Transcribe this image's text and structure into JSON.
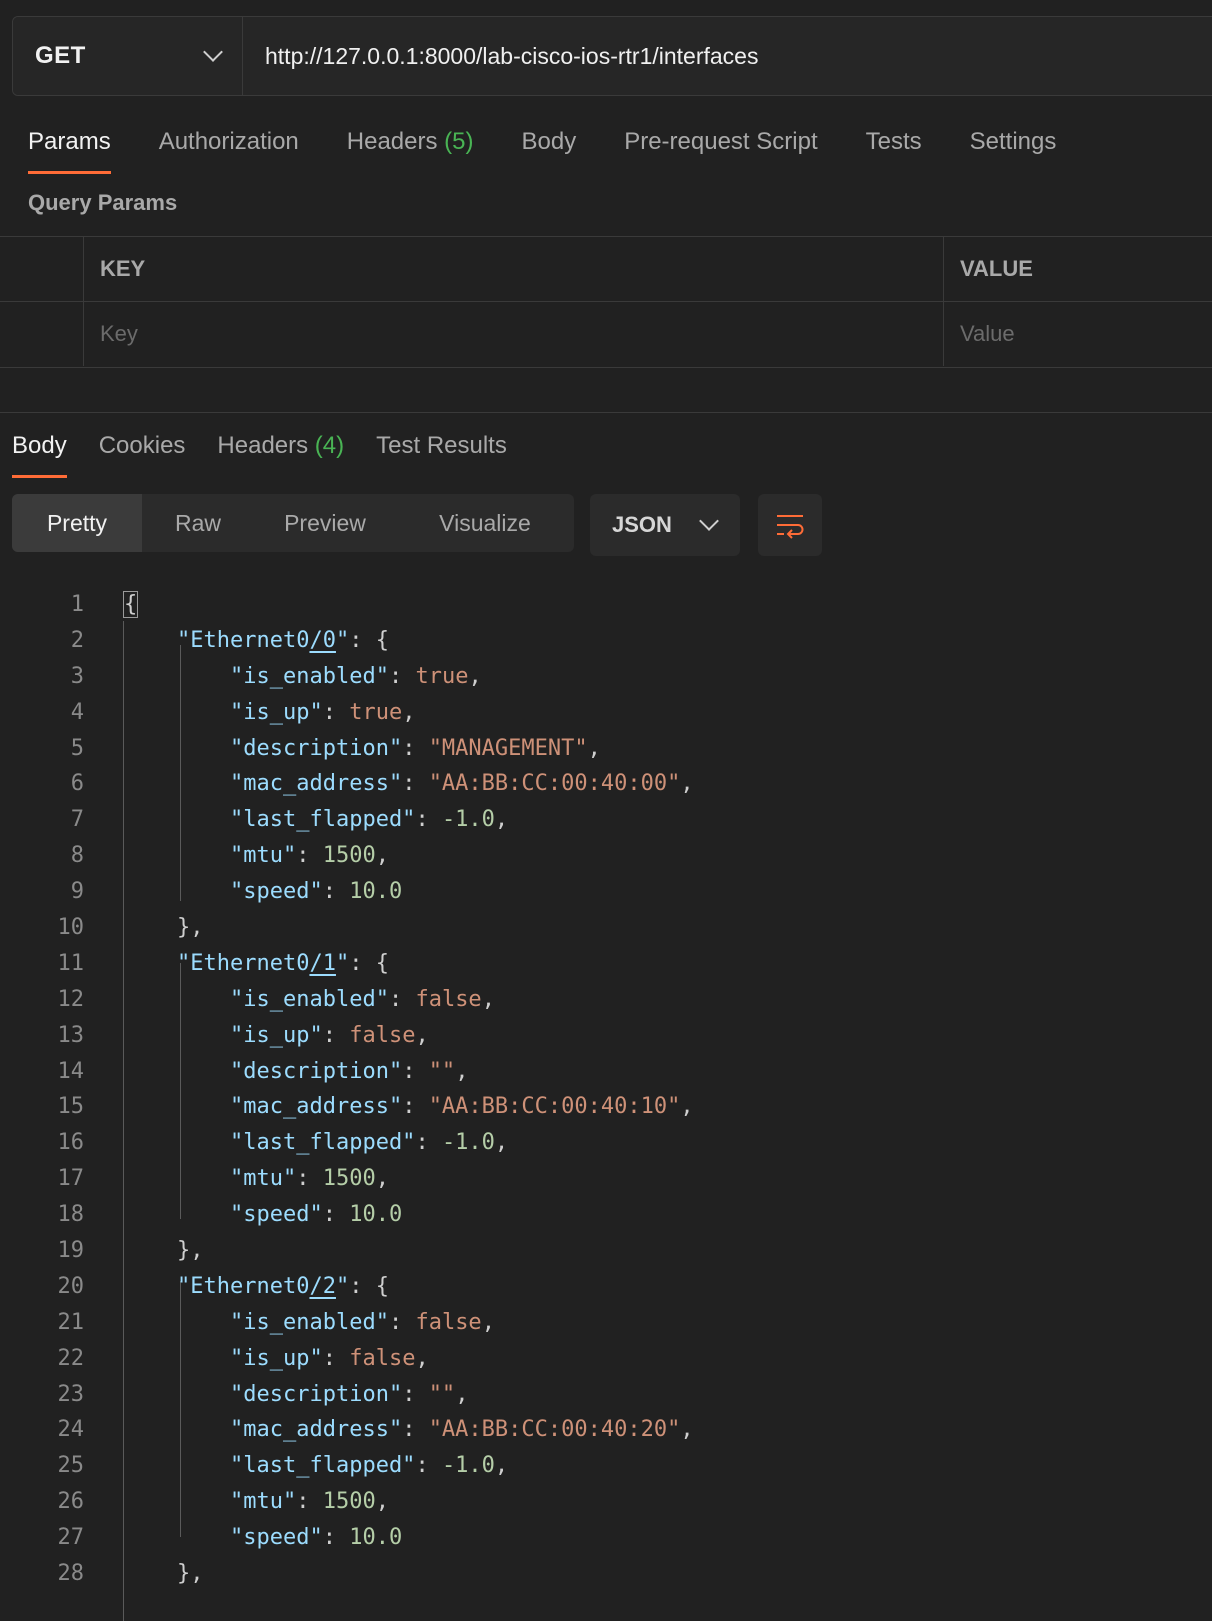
{
  "request": {
    "method": "GET",
    "url": "http://127.0.0.1:8000/lab-cisco-ios-rtr1/interfaces",
    "tabs": [
      {
        "label": "Params",
        "count": ""
      },
      {
        "label": "Authorization",
        "count": ""
      },
      {
        "label": "Headers",
        "count": "(5)"
      },
      {
        "label": "Body",
        "count": ""
      },
      {
        "label": "Pre-request Script",
        "count": ""
      },
      {
        "label": "Tests",
        "count": ""
      },
      {
        "label": "Settings",
        "count": ""
      }
    ],
    "active_tab": "Params"
  },
  "query_params": {
    "title": "Query Params",
    "col_key": "KEY",
    "col_value": "VALUE",
    "key_placeholder": "Key",
    "value_placeholder": "Value"
  },
  "response": {
    "tabs": [
      {
        "label": "Body",
        "count": ""
      },
      {
        "label": "Cookies",
        "count": ""
      },
      {
        "label": "Headers",
        "count": "(4)"
      },
      {
        "label": "Test Results",
        "count": ""
      }
    ],
    "active_tab": "Body",
    "view_modes": [
      "Pretty",
      "Raw",
      "Preview",
      "Visualize"
    ],
    "active_view": "Pretty",
    "format": "JSON",
    "wrap_icon": "wrap-lines-icon"
  },
  "code_lines": [
    {
      "n": "1",
      "text": "{"
    },
    {
      "n": "2",
      "text": "    \"Ethernet0/0\": {"
    },
    {
      "n": "3",
      "text": "        \"is_enabled\": true,"
    },
    {
      "n": "4",
      "text": "        \"is_up\": true,"
    },
    {
      "n": "5",
      "text": "        \"description\": \"MANAGEMENT\","
    },
    {
      "n": "6",
      "text": "        \"mac_address\": \"AA:BB:CC:00:40:00\","
    },
    {
      "n": "7",
      "text": "        \"last_flapped\": -1.0,"
    },
    {
      "n": "8",
      "text": "        \"mtu\": 1500,"
    },
    {
      "n": "9",
      "text": "        \"speed\": 10.0"
    },
    {
      "n": "10",
      "text": "    },"
    },
    {
      "n": "11",
      "text": "    \"Ethernet0/1\": {"
    },
    {
      "n": "12",
      "text": "        \"is_enabled\": false,"
    },
    {
      "n": "13",
      "text": "        \"is_up\": false,"
    },
    {
      "n": "14",
      "text": "        \"description\": \"\","
    },
    {
      "n": "15",
      "text": "        \"mac_address\": \"AA:BB:CC:00:40:10\","
    },
    {
      "n": "16",
      "text": "        \"last_flapped\": -1.0,"
    },
    {
      "n": "17",
      "text": "        \"mtu\": 1500,"
    },
    {
      "n": "18",
      "text": "        \"speed\": 10.0"
    },
    {
      "n": "19",
      "text": "    },"
    },
    {
      "n": "20",
      "text": "    \"Ethernet0/2\": {"
    },
    {
      "n": "21",
      "text": "        \"is_enabled\": false,"
    },
    {
      "n": "22",
      "text": "        \"is_up\": false,"
    },
    {
      "n": "23",
      "text": "        \"description\": \"\","
    },
    {
      "n": "24",
      "text": "        \"mac_address\": \"AA:BB:CC:00:40:20\","
    },
    {
      "n": "25",
      "text": "        \"last_flapped\": -1.0,"
    },
    {
      "n": "26",
      "text": "        \"mtu\": 1500,"
    },
    {
      "n": "27",
      "text": "        \"speed\": 10.0"
    },
    {
      "n": "28",
      "text": "    },"
    }
  ],
  "colors": {
    "accent": "#ff6c37",
    "count_green": "#49b454",
    "json_key": "#9cdcfe",
    "json_string": "#ce9178",
    "json_number": "#b5cea8"
  }
}
